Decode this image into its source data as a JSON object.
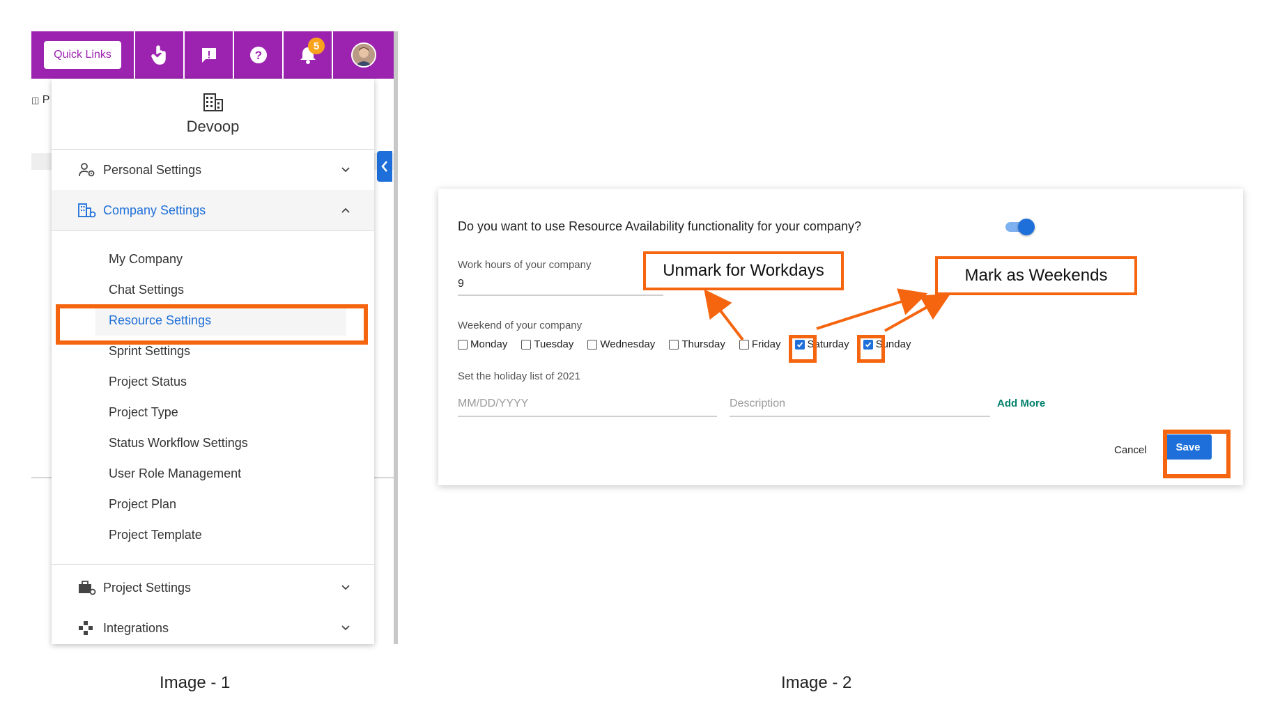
{
  "image1": {
    "topbar": {
      "quick_links_label": "Quick Links",
      "notification_count": "5"
    },
    "background_partial_text": "P",
    "menu": {
      "company_name": "Devoop",
      "sections": {
        "personal": "Personal Settings",
        "company": "Company Settings",
        "project": "Project Settings",
        "integrations": "Integrations"
      },
      "company_items": [
        "My Company",
        "Chat Settings",
        "Resource Settings",
        "Sprint Settings",
        "Project Status",
        "Project Type",
        "Status Workflow Settings",
        "User Role Management",
        "Project Plan",
        "Project Template"
      ]
    },
    "caption": "Image - 1"
  },
  "image2": {
    "question": "Do you want to use Resource Availability functionality for your company?",
    "work_hours": {
      "label": "Work hours of your company",
      "value": "9"
    },
    "weekend": {
      "label": "Weekend of your company",
      "days": [
        {
          "label": "Monday",
          "checked": false
        },
        {
          "label": "Tuesday",
          "checked": false
        },
        {
          "label": "Wednesday",
          "checked": false
        },
        {
          "label": "Thursday",
          "checked": false
        },
        {
          "label": "Friday",
          "checked": false
        },
        {
          "label": "Saturday",
          "checked": true
        },
        {
          "label": "Sunday",
          "checked": true
        }
      ]
    },
    "holiday": {
      "label": "Set the holiday list of 2021",
      "date_placeholder": "MM/DD/YYYY",
      "description_placeholder": "Description",
      "add_more": "Add More"
    },
    "actions": {
      "cancel": "Cancel",
      "save": "Save"
    },
    "callouts": {
      "unmark": "Unmark for Workdays",
      "mark": "Mark as Weekends"
    },
    "caption": "Image - 2"
  },
  "colors": {
    "topbar_purple": "#9c23b0",
    "accent_blue": "#1e6fd9",
    "highlight_orange": "#f5650f",
    "badge_orange": "#f9a21c",
    "add_more_green": "#00806b"
  }
}
